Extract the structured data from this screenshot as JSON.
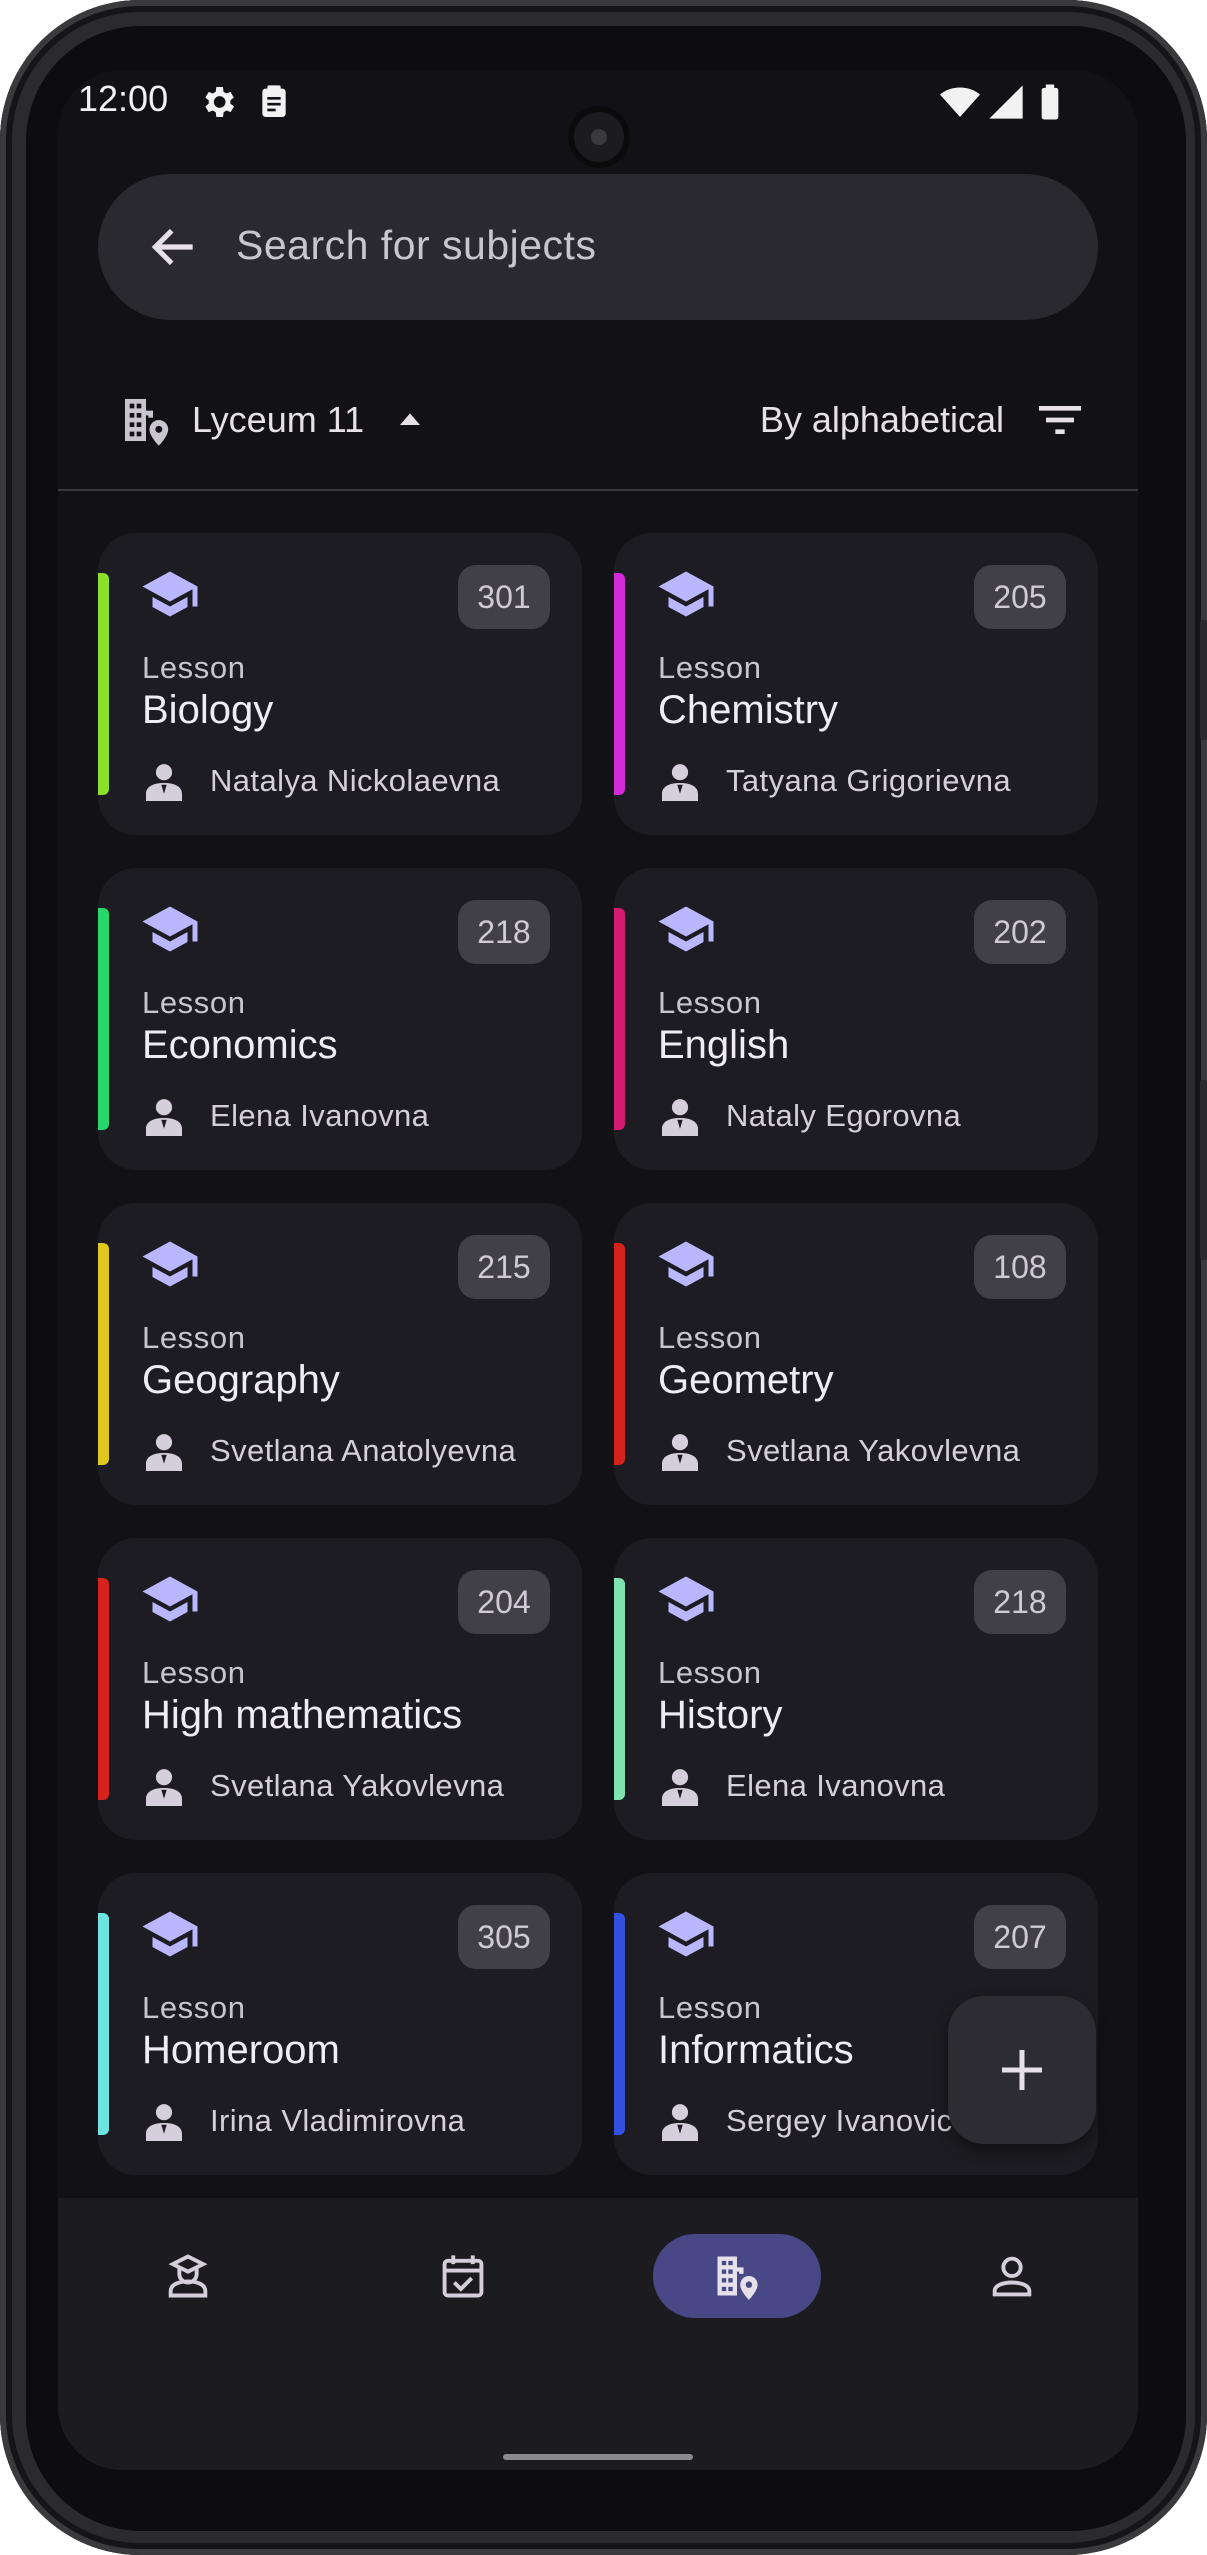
{
  "status_bar": {
    "time": "12:00",
    "icons": [
      "gear-icon",
      "clipboard-icon",
      "wifi-icon",
      "signal-icon",
      "battery-icon"
    ]
  },
  "search": {
    "placeholder": "Search for subjects",
    "back_icon": "arrow-back-icon"
  },
  "filters": {
    "school": "Lyceum 11",
    "school_icon": "building-location-icon",
    "sort_label": "By alphabetical",
    "sort_icon": "filter-list-icon"
  },
  "lessons": [
    {
      "type": "Lesson",
      "title": "Biology",
      "teacher": "Natalya Nickolaevna",
      "room": "301",
      "color": "#8be02a"
    },
    {
      "type": "Lesson",
      "title": "Chemistry",
      "teacher": "Tatyana Grigorievna",
      "room": "205",
      "color": "#d52ad8"
    },
    {
      "type": "Lesson",
      "title": "Economics",
      "teacher": "Elena Ivanovna",
      "room": "218",
      "color": "#26d86a"
    },
    {
      "type": "Lesson",
      "title": "English",
      "teacher": "Nataly Egorovna",
      "room": "202",
      "color": "#d81b72"
    },
    {
      "type": "Lesson",
      "title": "Geography",
      "teacher": "Svetlana Anatolyevna",
      "room": "215",
      "color": "#e0c71b"
    },
    {
      "type": "Lesson",
      "title": "Geometry",
      "teacher": "Svetlana Yakovlevna",
      "room": "108",
      "color": "#d3231b"
    },
    {
      "type": "Lesson",
      "title": "High mathematics",
      "teacher": "Svetlana Yakovlevna",
      "room": "204",
      "color": "#d6231e"
    },
    {
      "type": "Lesson",
      "title": "History",
      "teacher": "Elena Ivanovna",
      "room": "218",
      "color": "#7fe3b0"
    },
    {
      "type": "Lesson",
      "title": "Homeroom",
      "teacher": "Irina Vladimirovna",
      "room": "305",
      "color": "#6fe3e0"
    },
    {
      "type": "Lesson",
      "title": "Informatics",
      "teacher": "Sergey Ivanovic",
      "room": "207",
      "color": "#3450e0"
    }
  ],
  "fab": {
    "icon": "plus-icon"
  },
  "bottom_nav": [
    {
      "icon": "teacher-icon",
      "active": false
    },
    {
      "icon": "calendar-check-icon",
      "active": false
    },
    {
      "icon": "building-location-icon",
      "active": true
    },
    {
      "icon": "person-icon",
      "active": false
    }
  ],
  "colors": {
    "background": "#121216",
    "card": "#1d1c22",
    "accent": "#b9b7ff",
    "nav_active": "#494886"
  }
}
